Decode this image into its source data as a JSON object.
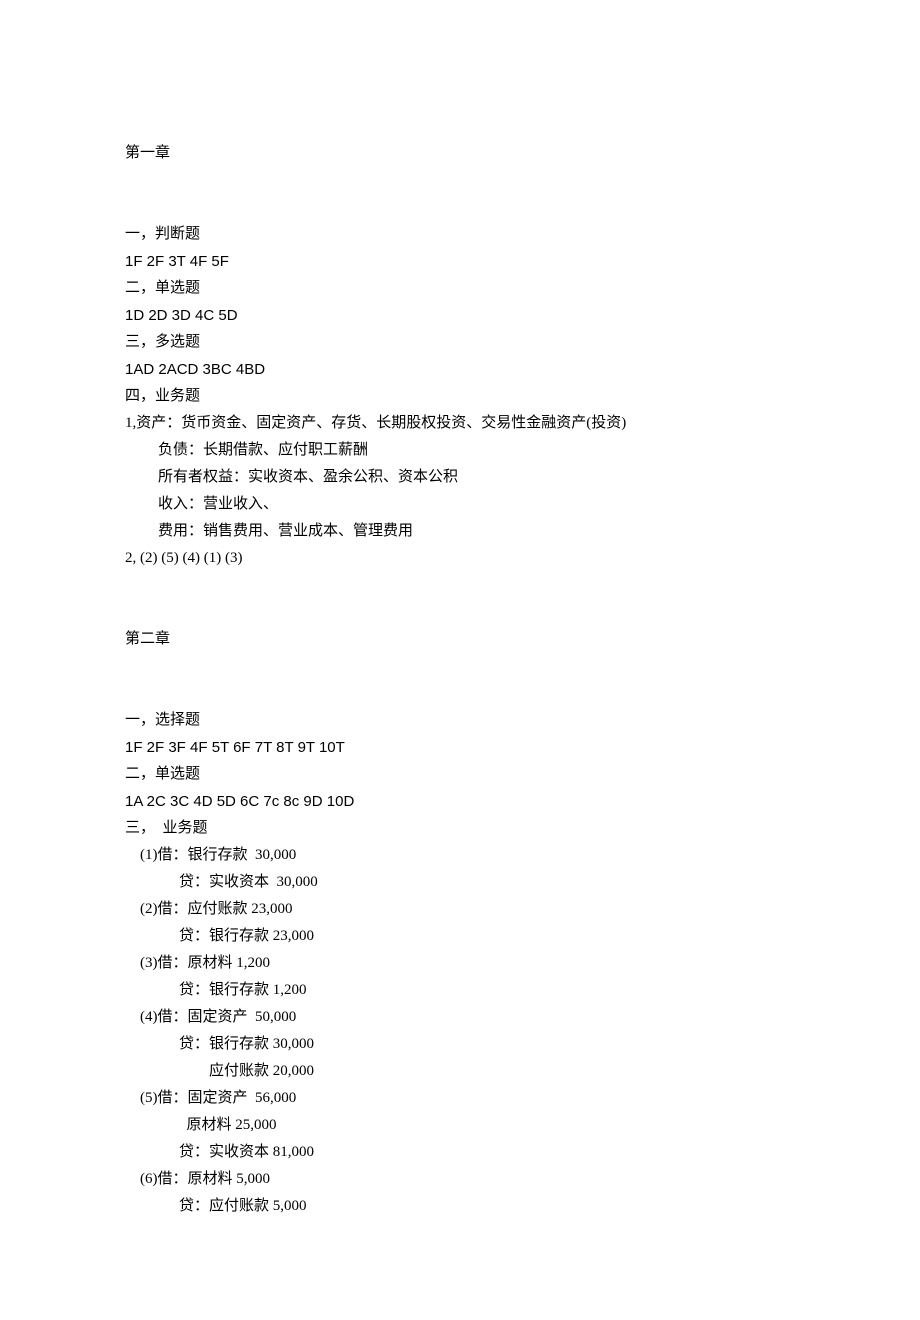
{
  "chapter1": {
    "title": "第一章",
    "sections": {
      "s1_label": "一，判断题",
      "s1_answers": "1F 2F 3T 4F 5F",
      "s2_label": "二，单选题",
      "s2_answers": "1D 2D 3D 4C 5D",
      "s3_label": "三，多选题",
      "s3_answers": "1AD 2ACD 3BC 4BD",
      "s4_label": "四，业务题",
      "q1_line1": "1,资产：货币资金、固定资产、存货、长期股权投资、交易性金融资产(投资)",
      "q1_line2": "负债：长期借款、应付职工薪酬",
      "q1_line3": "所有者权益：实收资本、盈余公积、资本公积",
      "q1_line4": "收入：营业收入、",
      "q1_line5": "费用：销售费用、营业成本、管理费用",
      "q2": "2, (2) (5) (4) (1) (3)"
    }
  },
  "chapter2": {
    "title": "第二章",
    "sections": {
      "s1_label": "一，选择题",
      "s1_answers": "1F 2F 3F 4F 5T 6F 7T 8T 9T 10T",
      "s2_label": "二，单选题",
      "s2_answers": "1A 2C 3C 4D 5D 6C 7c 8c 9D 10D",
      "s3_label": "三，  业务题",
      "entries": {
        "e1_d": "(1)借：银行存款  30,000",
        "e1_c": "贷：实收资本  30,000",
        "e2_d": "(2)借：应付账款 23,000",
        "e2_c": "贷：银行存款 23,000",
        "e3_d": "(3)借：原材料 1,200",
        "e3_c": "贷：银行存款 1,200",
        "e4_d": "(4)借：固定资产  50,000",
        "e4_c1": "贷：银行存款 30,000",
        "e4_c2": "应付账款 20,000",
        "e5_d1": "(5)借：固定资产  56,000",
        "e5_d2": "原材料 25,000",
        "e5_c": "贷：实收资本 81,000",
        "e6_d": "(6)借：原材料 5,000",
        "e6_c": "贷：应付账款 5,000"
      }
    }
  }
}
